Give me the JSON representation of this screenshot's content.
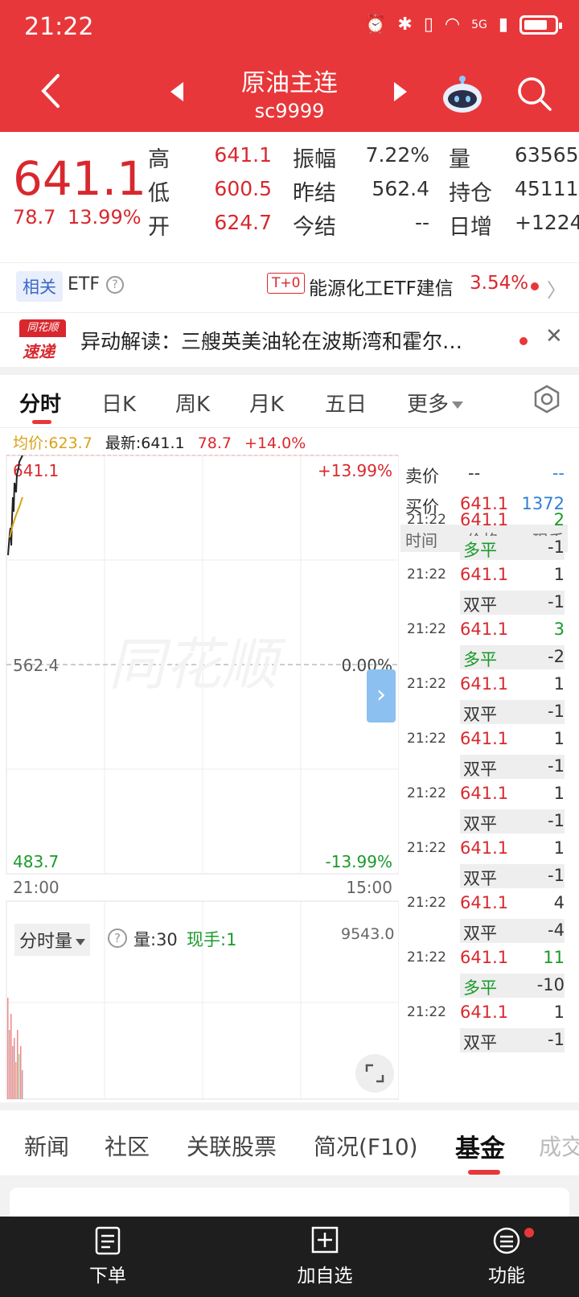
{
  "status": {
    "time": "21:22",
    "network": "5G"
  },
  "header": {
    "name": "原油主连",
    "code": "sc9999"
  },
  "quote": {
    "price": "641.1",
    "change": "78.7",
    "change_pct": "13.99%",
    "high_label": "高",
    "high": "641.1",
    "low_label": "低",
    "low": "600.5",
    "open_label": "开",
    "open": "624.7",
    "amp_label": "振幅",
    "amp": "7.22%",
    "prev_settle_label": "昨结",
    "prev_settle": "562.4",
    "settle_label": "今结",
    "settle": "--",
    "vol_label": "量",
    "vol": "63565",
    "oi_label": "持仓",
    "oi": "45111",
    "daily_inc_label": "日增",
    "daily_inc": "+1224"
  },
  "etf": {
    "tag": "相关",
    "label": "ETF",
    "badge": "T+0",
    "name": "能源化工ETF建信",
    "pct": "3.54%"
  },
  "news": {
    "logo_top": "同花顺",
    "logo_bottom": "速递",
    "text": "异动解读：三艘英美油轮在波斯湾和霍尔…"
  },
  "period_tabs": [
    "分时",
    "日K",
    "周K",
    "月K",
    "五日",
    "更多"
  ],
  "chart_header": {
    "avg": "均价:623.7",
    "latest": "最新:641.1",
    "change": "78.7",
    "pct": "+14.0%"
  },
  "chart_labels": {
    "top_price": "641.1",
    "top_pct": "+13.99%",
    "mid_price": "562.4",
    "mid_pct": "0.00%",
    "bottom_price": "483.7",
    "bottom_pct": "-13.99%",
    "time_start": "21:00",
    "time_end": "15:00"
  },
  "volume": {
    "selector": "分时量",
    "amount": "量:30",
    "hand": "现手:1",
    "max": "9543.0"
  },
  "order_book": {
    "sell_label": "卖价",
    "sell_price": "--",
    "sell_vol": "--",
    "buy_label": "买价",
    "buy_price": "641.1",
    "buy_vol": "1372",
    "col_time": "时间",
    "col_price": "价格",
    "col_hand": "现手"
  },
  "trades": [
    {
      "time": "21:22",
      "price": "641.1",
      "vol": "2",
      "vol_color": "green",
      "type": "多平",
      "type_color": "green",
      "chg": "-1"
    },
    {
      "time": "21:22",
      "price": "641.1",
      "vol": "1",
      "vol_color": "dark",
      "type": "双平",
      "type_color": "dark",
      "chg": "-1"
    },
    {
      "time": "21:22",
      "price": "641.1",
      "vol": "3",
      "vol_color": "green",
      "type": "多平",
      "type_color": "green",
      "chg": "-2"
    },
    {
      "time": "21:22",
      "price": "641.1",
      "vol": "1",
      "vol_color": "dark",
      "type": "双平",
      "type_color": "dark",
      "chg": "-1"
    },
    {
      "time": "21:22",
      "price": "641.1",
      "vol": "1",
      "vol_color": "dark",
      "type": "双平",
      "type_color": "dark",
      "chg": "-1"
    },
    {
      "time": "21:22",
      "price": "641.1",
      "vol": "1",
      "vol_color": "dark",
      "type": "双平",
      "type_color": "dark",
      "chg": "-1"
    },
    {
      "time": "21:22",
      "price": "641.1",
      "vol": "1",
      "vol_color": "dark",
      "type": "双平",
      "type_color": "dark",
      "chg": "-1"
    },
    {
      "time": "21:22",
      "price": "641.1",
      "vol": "4",
      "vol_color": "dark",
      "type": "双平",
      "type_color": "dark",
      "chg": "-4"
    },
    {
      "time": "21:22",
      "price": "641.1",
      "vol": "11",
      "vol_color": "green",
      "type": "多平",
      "type_color": "green",
      "chg": "-10"
    },
    {
      "time": "21:22",
      "price": "641.1",
      "vol": "1",
      "vol_color": "dark",
      "type": "双平",
      "type_color": "dark",
      "chg": "-1"
    }
  ],
  "info_tabs": [
    "新闻",
    "社区",
    "关联股票",
    "简况(F10)",
    "基金",
    "成交"
  ],
  "bottom_nav": {
    "order": "下单",
    "add": "加自选",
    "func": "功能"
  },
  "watermark": "同花顺",
  "colors": {
    "brand": "#e8373a",
    "up": "#d8282e",
    "down": "#1a9a2a",
    "avg": "#d9a31a"
  }
}
